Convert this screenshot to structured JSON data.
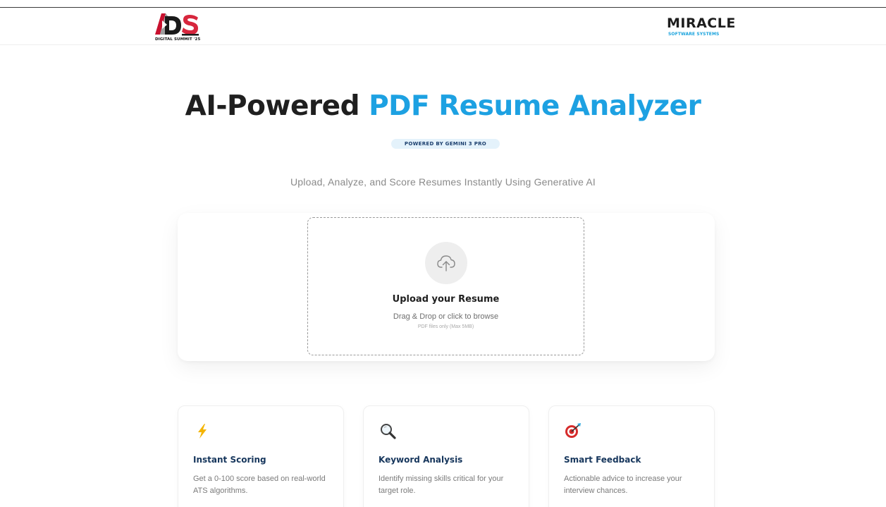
{
  "header": {
    "left_logo": {
      "text": "DS",
      "tagline": "DIGITAL SUMMIT '25",
      "colors": {
        "a_red": "#c8102e",
        "a_gray": "#9e9e9e",
        "s_red": "#d7263d",
        "d_dark": "#1a1a1a"
      }
    },
    "right_logo": {
      "name": "MIRACLE",
      "subtitle": "SOFTWARE SYSTEMS",
      "colors": {
        "name": "#1d1d1d",
        "subtitle": "#1aa3dd"
      }
    }
  },
  "hero": {
    "title_part1": "AI-Powered",
    "title_part2": "PDF Resume Analyzer",
    "badge": "POWERED BY GEMINI 3 PRO",
    "subtitle": "Upload, Analyze, and Score Resumes Instantly Using Generative AI",
    "accent_color": "#1da1e2"
  },
  "upload": {
    "icon": "cloud-upload-icon",
    "title": "Upload your Resume",
    "instruction": "Drag & Drop or click to browse",
    "note": "PDF files only (Max 5MB)"
  },
  "features": [
    {
      "icon": "lightning-icon",
      "title": "Instant Scoring",
      "description": "Get a 0-100 score based on real-world ATS algorithms."
    },
    {
      "icon": "magnifier-icon",
      "title": "Keyword Analysis",
      "description": "Identify missing skills critical for your target role."
    },
    {
      "icon": "target-icon",
      "title": "Smart Feedback",
      "description": "Actionable advice to increase your interview chances."
    }
  ]
}
